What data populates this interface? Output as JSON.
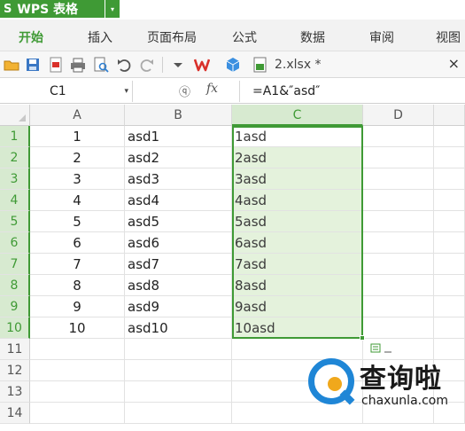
{
  "app": {
    "title": "WPS 表格",
    "logo_glyph": "S",
    "dropdown_glyph": "▾"
  },
  "ribbon": {
    "tabs": [
      {
        "label": "开始",
        "active": true
      },
      {
        "label": "插入",
        "active": false
      },
      {
        "label": "页面布局",
        "active": false
      },
      {
        "label": "公式",
        "active": false
      },
      {
        "label": "数据",
        "active": false
      },
      {
        "label": "审阅",
        "active": false
      },
      {
        "label": "视图",
        "active": false
      }
    ]
  },
  "toolbar": {
    "icons": [
      "open-folder-icon",
      "save-icon",
      "export-pdf-icon",
      "print-icon",
      "print-preview-icon",
      "undo-icon",
      "redo-icon",
      "customize-dropdown-icon",
      "wps-logo-icon",
      "cloud-cube-icon",
      "spreadsheet-file-icon"
    ],
    "file_name": "2.xlsx *",
    "close_glyph": "×"
  },
  "formula_bar": {
    "name_box": "C1",
    "name_box_caret": "▾",
    "zoom_glyph": "ⓠ",
    "fx_label": "fx",
    "formula": "=A1&″asd″"
  },
  "sheet": {
    "columns": [
      "A",
      "B",
      "C",
      "D"
    ],
    "selected_column": "C",
    "rows": [
      {
        "row": "1",
        "A": "1",
        "B": "asd1",
        "C": "1asd"
      },
      {
        "row": "2",
        "A": "2",
        "B": "asd2",
        "C": "2asd"
      },
      {
        "row": "3",
        "A": "3",
        "B": "asd3",
        "C": "3asd"
      },
      {
        "row": "4",
        "A": "4",
        "B": "asd4",
        "C": "4asd"
      },
      {
        "row": "5",
        "A": "5",
        "B": "asd5",
        "C": "5asd"
      },
      {
        "row": "6",
        "A": "6",
        "B": "asd6",
        "C": "6asd"
      },
      {
        "row": "7",
        "A": "7",
        "B": "asd7",
        "C": "7asd"
      },
      {
        "row": "8",
        "A": "8",
        "B": "asd8",
        "C": "8asd"
      },
      {
        "row": "9",
        "A": "9",
        "B": "asd9",
        "C": "9asd"
      },
      {
        "row": "10",
        "A": "10",
        "B": "asd10",
        "C": "10asd"
      },
      {
        "row": "11",
        "A": "",
        "B": "",
        "C": ""
      },
      {
        "row": "12",
        "A": "",
        "B": "",
        "C": ""
      },
      {
        "row": "13",
        "A": "",
        "B": "",
        "C": ""
      },
      {
        "row": "14",
        "A": "",
        "B": "",
        "C": ""
      }
    ],
    "selection": "C1:C10"
  },
  "watermark": {
    "title": "查询啦",
    "url": "chaxunla.com"
  },
  "colors": {
    "accent": "#3f9a35",
    "selection_fill": "#e4f2dc",
    "watermark_blue": "#1f86d6",
    "watermark_orange": "#f0a81c"
  }
}
